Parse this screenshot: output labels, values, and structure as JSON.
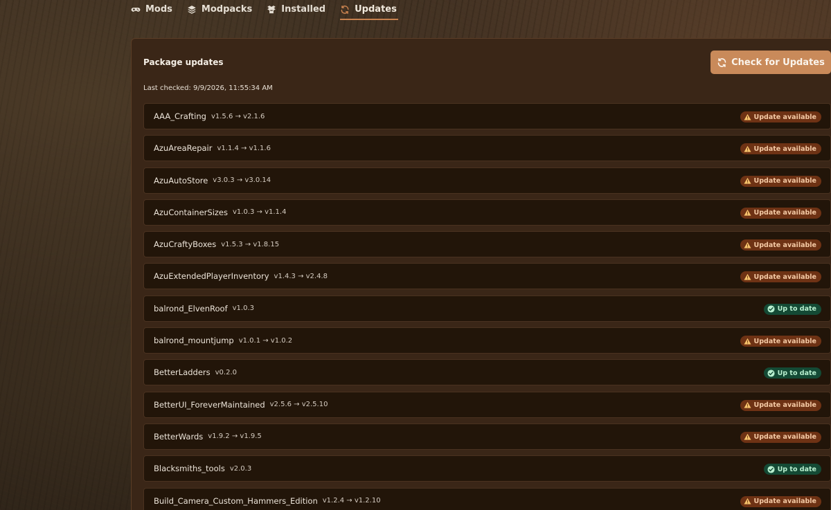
{
  "nav": {
    "tabs": [
      {
        "label": "Mods",
        "icon": "gamepad-icon"
      },
      {
        "label": "Modpacks",
        "icon": "layers-icon"
      },
      {
        "label": "Installed",
        "icon": "box-icon"
      },
      {
        "label": "Updates",
        "icon": "refresh-icon",
        "active": true
      }
    ]
  },
  "panel": {
    "title": "Package updates",
    "last_checked": "Last checked: 9/9/2026, 11:55:34 AM",
    "check_button_label": "Check for Updates"
  },
  "status_labels": {
    "update": "Update available",
    "ok": "Up to date"
  },
  "colors": {
    "accent": "#c98a5a",
    "update_badge_bg": "#6e3214",
    "ok_badge_bg": "#144a35"
  },
  "packages": [
    {
      "name": "AAA_Crafting",
      "version": "v1.5.6 → v2.1.6",
      "status": "update"
    },
    {
      "name": "AzuAreaRepair",
      "version": "v1.1.4 → v1.1.6",
      "status": "update"
    },
    {
      "name": "AzuAutoStore",
      "version": "v3.0.3 → v3.0.14",
      "status": "update"
    },
    {
      "name": "AzuContainerSizes",
      "version": "v1.0.3 → v1.1.4",
      "status": "update"
    },
    {
      "name": "AzuCraftyBoxes",
      "version": "v1.5.3 → v1.8.15",
      "status": "update"
    },
    {
      "name": "AzuExtendedPlayerInventory",
      "version": "v1.4.3 → v2.4.8",
      "status": "update"
    },
    {
      "name": "balrond_ElvenRoof",
      "version": "v1.0.3",
      "status": "ok"
    },
    {
      "name": "balrond_mountjump",
      "version": "v1.0.1 → v1.0.2",
      "status": "update"
    },
    {
      "name": "BetterLadders",
      "version": "v0.2.0",
      "status": "ok"
    },
    {
      "name": "BetterUI_ForeverMaintained",
      "version": "v2.5.6 → v2.5.10",
      "status": "update"
    },
    {
      "name": "BetterWards",
      "version": "v1.9.2 → v1.9.5",
      "status": "update"
    },
    {
      "name": "Blacksmiths_tools",
      "version": "v2.0.3",
      "status": "ok"
    },
    {
      "name": "Build_Camera_Custom_Hammers_Edition",
      "version": "v1.2.4 → v1.2.10",
      "status": "update"
    }
  ]
}
